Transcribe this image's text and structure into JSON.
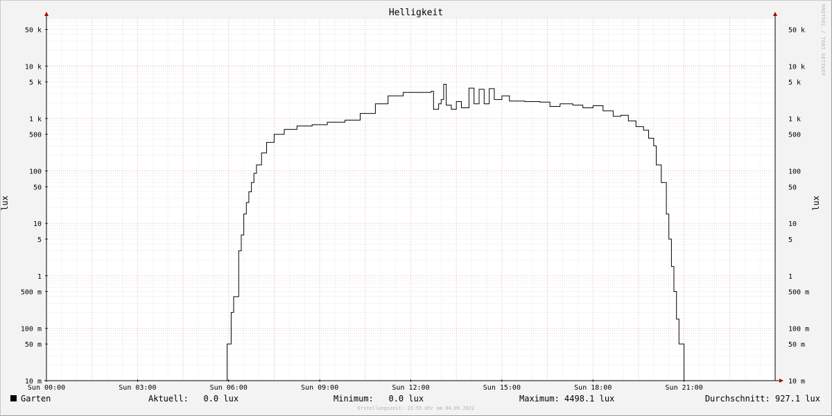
{
  "chart_data": {
    "type": "line",
    "title": "Helligkeit",
    "ylabel": "lux",
    "yscale": "log",
    "ylim": [
      0.01,
      80000
    ],
    "xlim": [
      "00:00",
      "24:00"
    ],
    "y_ticks": [
      {
        "value": 50000,
        "label": "50 k"
      },
      {
        "value": 10000,
        "label": "10 k"
      },
      {
        "value": 5000,
        "label": "5 k"
      },
      {
        "value": 1000,
        "label": "1 k"
      },
      {
        "value": 500,
        "label": "500"
      },
      {
        "value": 100,
        "label": "100"
      },
      {
        "value": 50,
        "label": "50"
      },
      {
        "value": 10,
        "label": "10"
      },
      {
        "value": 5,
        "label": "5"
      },
      {
        "value": 1,
        "label": "1"
      },
      {
        "value": 0.5,
        "label": "500 m"
      },
      {
        "value": 0.1,
        "label": "100 m"
      },
      {
        "value": 0.05,
        "label": "50 m"
      },
      {
        "value": 0.01,
        "label": "10 m"
      }
    ],
    "x_ticks": [
      {
        "value": "00:00",
        "label": "Sun 00:00"
      },
      {
        "value": "03:00",
        "label": "Sun 03:00"
      },
      {
        "value": "06:00",
        "label": "Sun 06:00"
      },
      {
        "value": "09:00",
        "label": "Sun 09:00"
      },
      {
        "value": "12:00",
        "label": "Sun 12:00"
      },
      {
        "value": "15:00",
        "label": "Sun 15:00"
      },
      {
        "value": "18:00",
        "label": "Sun 18:00"
      },
      {
        "value": "21:00",
        "label": "Sun 21:00"
      }
    ],
    "grid": true,
    "series": [
      {
        "name": "Garten",
        "color": "#000000",
        "points": [
          [
            "00:00",
            0.01
          ],
          [
            "05:55",
            0.01
          ],
          [
            "05:57",
            0.05
          ],
          [
            "06:05",
            0.2
          ],
          [
            "06:10",
            0.4
          ],
          [
            "06:20",
            3
          ],
          [
            "06:25",
            6
          ],
          [
            "06:30",
            15
          ],
          [
            "06:35",
            25
          ],
          [
            "06:40",
            40
          ],
          [
            "06:45",
            60
          ],
          [
            "06:50",
            90
          ],
          [
            "06:55",
            130
          ],
          [
            "07:05",
            220
          ],
          [
            "07:15",
            350
          ],
          [
            "07:30",
            500
          ],
          [
            "07:50",
            620
          ],
          [
            "08:15",
            720
          ],
          [
            "08:45",
            760
          ],
          [
            "09:15",
            850
          ],
          [
            "09:50",
            930
          ],
          [
            "10:20",
            1250
          ],
          [
            "10:50",
            1900
          ],
          [
            "11:15",
            2700
          ],
          [
            "11:45",
            3150
          ],
          [
            "12:40",
            3300
          ],
          [
            "12:45",
            1500
          ],
          [
            "12:55",
            1900
          ],
          [
            "13:00",
            2300
          ],
          [
            "13:05",
            4498.1
          ],
          [
            "13:10",
            1800
          ],
          [
            "13:20",
            1500
          ],
          [
            "13:30",
            2100
          ],
          [
            "13:40",
            1600
          ],
          [
            "13:55",
            3800
          ],
          [
            "14:05",
            1900
          ],
          [
            "14:15",
            3600
          ],
          [
            "14:25",
            1900
          ],
          [
            "14:35",
            3700
          ],
          [
            "14:45",
            2300
          ],
          [
            "15:00",
            2700
          ],
          [
            "15:15",
            2150
          ],
          [
            "15:45",
            2100
          ],
          [
            "16:15",
            2050
          ],
          [
            "16:35",
            1700
          ],
          [
            "16:55",
            1900
          ],
          [
            "17:20",
            1800
          ],
          [
            "17:40",
            1600
          ],
          [
            "18:00",
            1750
          ],
          [
            "18:20",
            1400
          ],
          [
            "18:40",
            1100
          ],
          [
            "18:55",
            1150
          ],
          [
            "19:10",
            900
          ],
          [
            "19:25",
            700
          ],
          [
            "19:40",
            600
          ],
          [
            "19:50",
            420
          ],
          [
            "20:00",
            300
          ],
          [
            "20:05",
            130
          ],
          [
            "20:15",
            60
          ],
          [
            "20:25",
            15
          ],
          [
            "20:30",
            5
          ],
          [
            "20:35",
            1.5
          ],
          [
            "20:40",
            0.5
          ],
          [
            "20:45",
            0.15
          ],
          [
            "20:50",
            0.05
          ],
          [
            "21:00",
            0.01
          ],
          [
            "24:00",
            0.01
          ]
        ]
      }
    ]
  },
  "legend": {
    "series_name": "Garten",
    "current": "Aktuell:   0.0 lux",
    "minimum": "Minimum:   0.0 lux",
    "maximum": "Maximum: 4498.1 lux",
    "average": "Durchschnitt: 927.1 lux"
  },
  "watermark": "RRDTOOL / TOBI OETIKER",
  "footer": "Erstellungszeit: 23:55 Uhr am 04.09.2022",
  "colors": {
    "background": "#f3f3f3",
    "plot_background": "#ffffff",
    "grid_major": "#e6a0a0",
    "grid_minor": "#cfcfcf",
    "axis": "#000000",
    "arrow": "#aa0000"
  }
}
